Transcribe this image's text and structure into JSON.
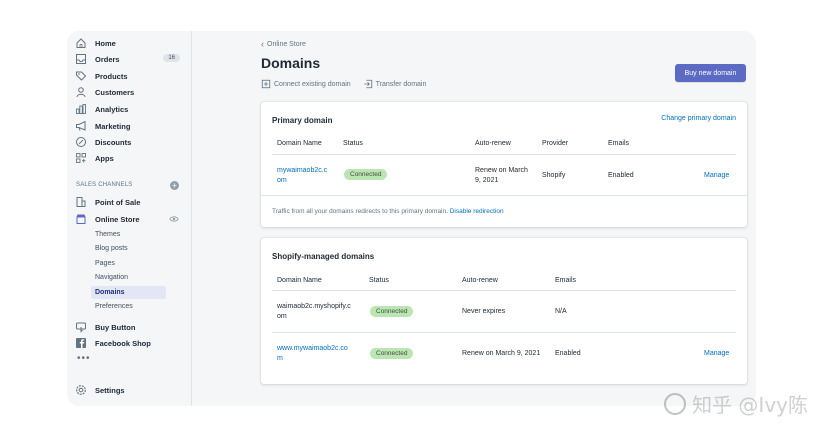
{
  "sidebar": {
    "nav": [
      {
        "label": "Home",
        "icon": "home-icon"
      },
      {
        "label": "Orders",
        "icon": "orders-icon",
        "badge": "16"
      },
      {
        "label": "Products",
        "icon": "tag-icon"
      },
      {
        "label": "Customers",
        "icon": "person-icon"
      },
      {
        "label": "Analytics",
        "icon": "bar-chart-icon"
      },
      {
        "label": "Marketing",
        "icon": "megaphone-icon"
      },
      {
        "label": "Discounts",
        "icon": "discount-icon"
      },
      {
        "label": "Apps",
        "icon": "apps-icon"
      }
    ],
    "sales_channels_title": "SALES CHANNELS",
    "pos_label": "Point of Sale",
    "online_store_label": "Online Store",
    "sub_items": [
      "Themes",
      "Blog posts",
      "Pages",
      "Navigation",
      "Domains",
      "Preferences"
    ],
    "buy_button_label": "Buy Button",
    "facebook_label": "Facebook Shop",
    "more_label": "•••",
    "settings_label": "Settings"
  },
  "header": {
    "breadcrumb": "Online Store",
    "title": "Domains",
    "connect_label": "Connect existing domain",
    "transfer_label": "Transfer domain",
    "buy_button": "Buy new domain"
  },
  "primary_card": {
    "title": "Primary domain",
    "change_link": "Change primary domain",
    "columns": [
      "Domain Name",
      "Status",
      "Auto-renew",
      "Provider",
      "Emails"
    ],
    "row": {
      "domain_line1": "mywaimaob2c.c",
      "domain_line2": "om",
      "status": "Connected",
      "renew_line1": "Renew on March",
      "renew_line2": "9, 2021",
      "provider": "Shopify",
      "emails": "Enabled",
      "manage": "Manage"
    },
    "note": "Traffic from all your domains redirects to this primary domain.",
    "note_link": "Disable redirection"
  },
  "managed_card": {
    "title": "Shopify-managed domains",
    "columns": [
      "Domain Name",
      "Status",
      "Auto-renew",
      "Emails"
    ],
    "rows": [
      {
        "domain_line1": "waimaob2c.myshopify.c",
        "domain_line2": "om",
        "status": "Connected",
        "renew": "Never expires",
        "emails": "N/A",
        "manage": ""
      },
      {
        "domain_line1": "www.mywaimaob2c.co",
        "domain_line2": "m",
        "status": "Connected",
        "renew": "Renew on March 9, 2021",
        "emails": "Enabled",
        "manage": "Manage"
      }
    ]
  },
  "watermark": "知乎 @Ivy陈"
}
